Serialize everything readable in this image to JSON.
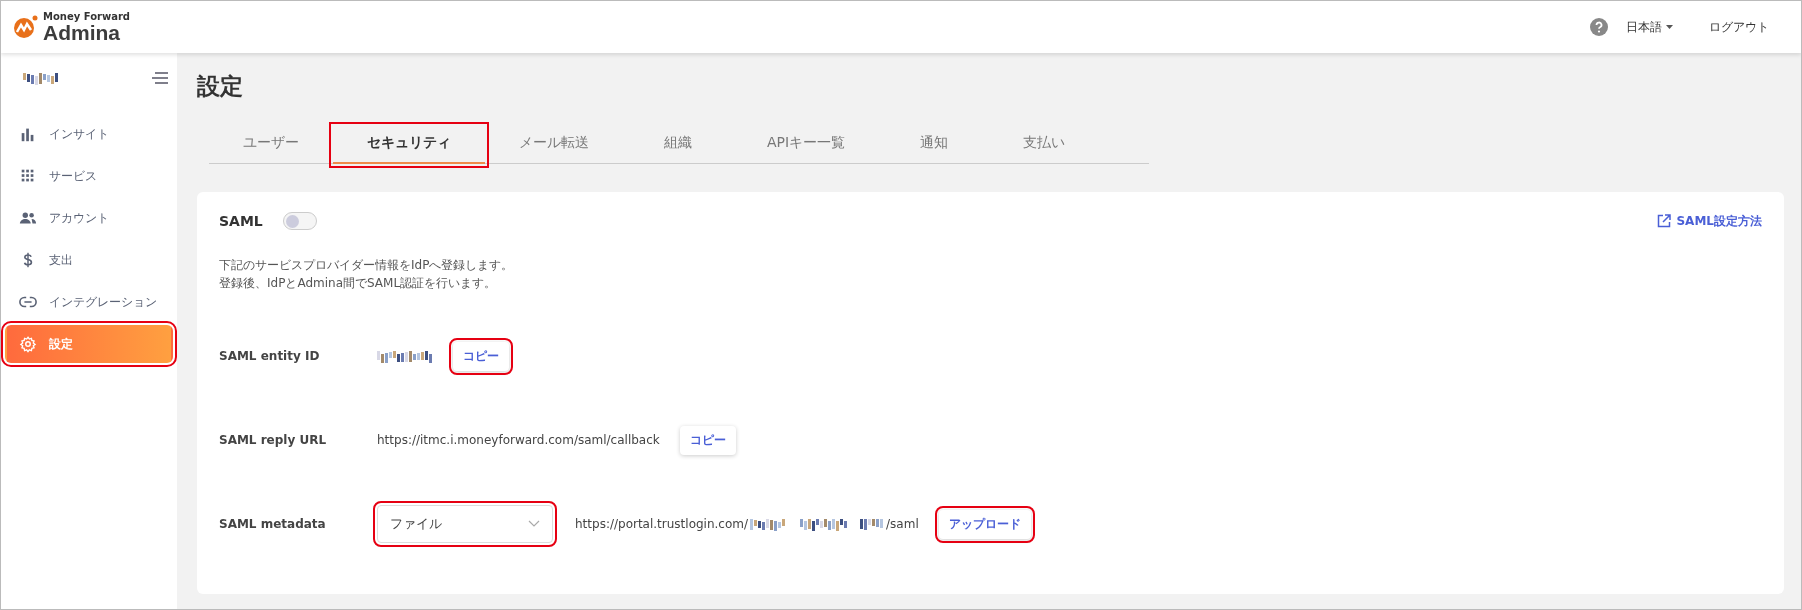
{
  "header": {
    "brand_small": "Money Forward",
    "brand": "Admina",
    "language": "日本語",
    "logout": "ログアウト"
  },
  "sidebar": {
    "items": [
      {
        "label": "インサイト",
        "selected": false,
        "highlighted": false
      },
      {
        "label": "サービス",
        "selected": false,
        "highlighted": false
      },
      {
        "label": "アカウント",
        "selected": false,
        "highlighted": false
      },
      {
        "label": "支出",
        "selected": false,
        "highlighted": false
      },
      {
        "label": "インテグレーション",
        "selected": false,
        "highlighted": false
      },
      {
        "label": "設定",
        "selected": true,
        "highlighted": true
      }
    ]
  },
  "page_title": "設定",
  "tabs": [
    {
      "label": "ユーザー",
      "selected": false,
      "highlighted": false
    },
    {
      "label": "セキュリティ",
      "selected": true,
      "highlighted": true
    },
    {
      "label": "メール転送",
      "selected": false,
      "highlighted": false
    },
    {
      "label": "組織",
      "selected": false,
      "highlighted": false
    },
    {
      "label": "APIキー一覧",
      "selected": false,
      "highlighted": false
    },
    {
      "label": "通知",
      "selected": false,
      "highlighted": false
    },
    {
      "label": "支払い",
      "selected": false,
      "highlighted": false
    }
  ],
  "saml": {
    "title": "SAML",
    "on": false,
    "help_link": "SAML設定方法",
    "description": [
      "下記のサービスプロバイダー情報をIdPへ登録します。",
      "登録後、IdPとAdmina間でSAML認証を行います。"
    ],
    "rows": [
      {
        "kind": "copy",
        "label": "SAML entity ID",
        "value_redacted": true,
        "button": "コピー",
        "highlighted": true
      },
      {
        "kind": "copy",
        "label": "SAML reply URL",
        "value": "https://itmc.i.moneyforward.com/saml/callback",
        "button": "コピー",
        "highlighted": false
      },
      {
        "kind": "upload",
        "label": "SAML metadata",
        "select": "ファイル",
        "select_highlighted": true,
        "url_start": "https://portal.trustlogin.com/",
        "url_end": "/saml",
        "button": "アップロード",
        "highlighted": true
      }
    ]
  }
}
